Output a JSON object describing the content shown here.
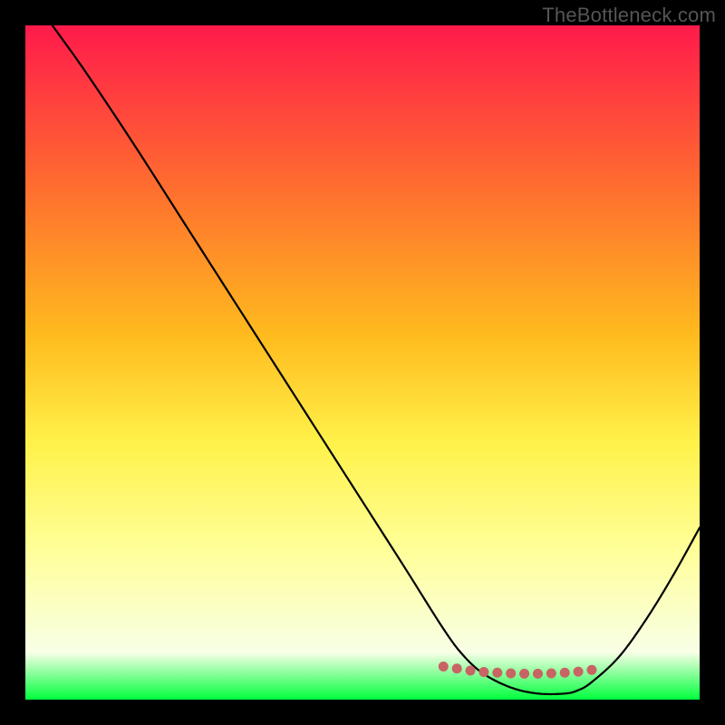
{
  "watermark": "TheBottleneck.com",
  "gradient": {
    "colors": [
      "#ff1a4b",
      "#ff6a30",
      "#ffbb1e",
      "#fff24a",
      "#ffff9a",
      "#f8ffe6",
      "#00ff3c"
    ],
    "stops": [
      0.0,
      0.23,
      0.46,
      0.62,
      0.78,
      0.93,
      1.0
    ]
  },
  "chart_data": {
    "type": "line",
    "title": "",
    "xlabel": "",
    "ylabel": "",
    "xlim": [
      0,
      100
    ],
    "ylim": [
      0,
      100
    ],
    "series": [
      {
        "name": "bottleneck-curve",
        "x": [
          4,
          9,
          16,
          24,
          32,
          40,
          48,
          56,
          62,
          65,
          68,
          72,
          76,
          80,
          82,
          84,
          88,
          92,
          96,
          100
        ],
        "values": [
          100,
          93,
          82.5,
          70,
          57.5,
          45,
          32.5,
          20,
          10.5,
          6.5,
          3.8,
          1.8,
          0.9,
          0.9,
          1.4,
          2.6,
          6.3,
          11.8,
          18.3,
          25.5
        ]
      },
      {
        "name": "dotted-band",
        "x": [
          62,
          64,
          66,
          68,
          70,
          72,
          74,
          76,
          78,
          80,
          82,
          84
        ],
        "values": [
          4.9,
          4.6,
          4.3,
          4.1,
          4.0,
          3.9,
          3.85,
          3.85,
          3.9,
          4.0,
          4.15,
          4.4
        ]
      }
    ]
  },
  "dotted_style": {
    "color": "#c86464",
    "radius_px": 5.5
  }
}
